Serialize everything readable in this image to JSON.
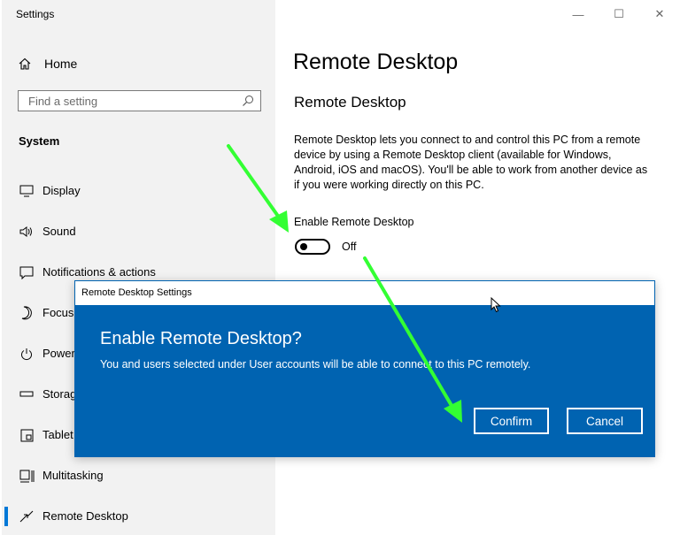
{
  "window": {
    "title": "Settings",
    "minimize": "—",
    "maximize": "☐",
    "close": "✕"
  },
  "sidebar": {
    "home_label": "Home",
    "search_placeholder": "Find a setting",
    "section_label": "System",
    "items": [
      {
        "label": "Display",
        "icon": "monitor-icon"
      },
      {
        "label": "Sound",
        "icon": "speaker-icon"
      },
      {
        "label": "Notifications & actions",
        "icon": "notification-icon"
      },
      {
        "label": "Focus assist",
        "icon": "moon-icon"
      },
      {
        "label": "Power & sleep",
        "icon": "power-icon"
      },
      {
        "label": "Storage",
        "icon": "storage-icon"
      },
      {
        "label": "Tablet",
        "icon": "tablet-icon"
      },
      {
        "label": "Multitasking",
        "icon": "multitasking-icon"
      },
      {
        "label": "Remote Desktop",
        "icon": "remote-desktop-icon",
        "active": true
      }
    ]
  },
  "main": {
    "title": "Remote Desktop",
    "subtitle": "Remote Desktop",
    "description": "Remote Desktop lets you connect to and control this PC from a remote device by using a Remote Desktop client (available for Windows, Android, iOS and macOS). You'll be able to work from another device as if you were working directly on this PC.",
    "toggle_label": "Enable Remote Desktop",
    "toggle_state": "Off"
  },
  "dialog": {
    "title": "Remote Desktop Settings",
    "heading": "Enable Remote Desktop?",
    "message": "You and users selected under User accounts will be able to connect to this PC remotely.",
    "confirm_label": "Confirm",
    "cancel_label": "Cancel"
  },
  "colors": {
    "accent": "#0078d7",
    "dialog_bg": "#0063b1",
    "annotation_arrow": "#33ff33"
  }
}
